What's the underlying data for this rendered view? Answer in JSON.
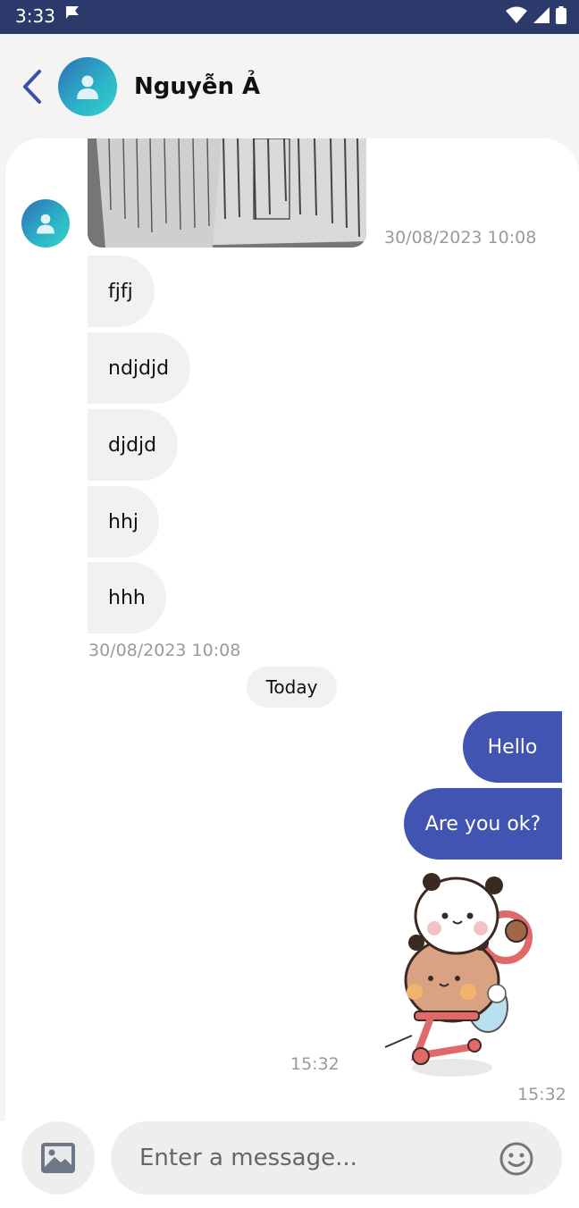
{
  "status_bar": {
    "time": "3:33"
  },
  "header": {
    "contact_name": "Nguyễn Ả"
  },
  "messages_incoming": [
    {
      "text": "fjfj"
    },
    {
      "text": "ndjdjd"
    },
    {
      "text": "djdjd"
    },
    {
      "text": "hhj"
    },
    {
      "text": "hhh"
    }
  ],
  "timestamps": {
    "photo": "30/08/2023 10:08",
    "incoming_group": "30/08/2023 10:08",
    "outgoing_text": "15:32",
    "sticker": "15:32"
  },
  "divider": {
    "label": "Today"
  },
  "messages_outgoing": [
    {
      "text": "Hello"
    },
    {
      "text": "Are you ok?"
    }
  ],
  "composer": {
    "placeholder": "Enter a message..."
  },
  "colors": {
    "outgoing_bubble": "#4254b1",
    "incoming_bubble": "#f1f1f1",
    "status_bar": "#2b3a6b",
    "back_arrow": "#3f4fa8"
  },
  "icons": [
    "back-arrow-icon",
    "user-icon",
    "image-icon",
    "emoji-icon",
    "wifi-icon",
    "signal-icon",
    "battery-icon"
  ]
}
